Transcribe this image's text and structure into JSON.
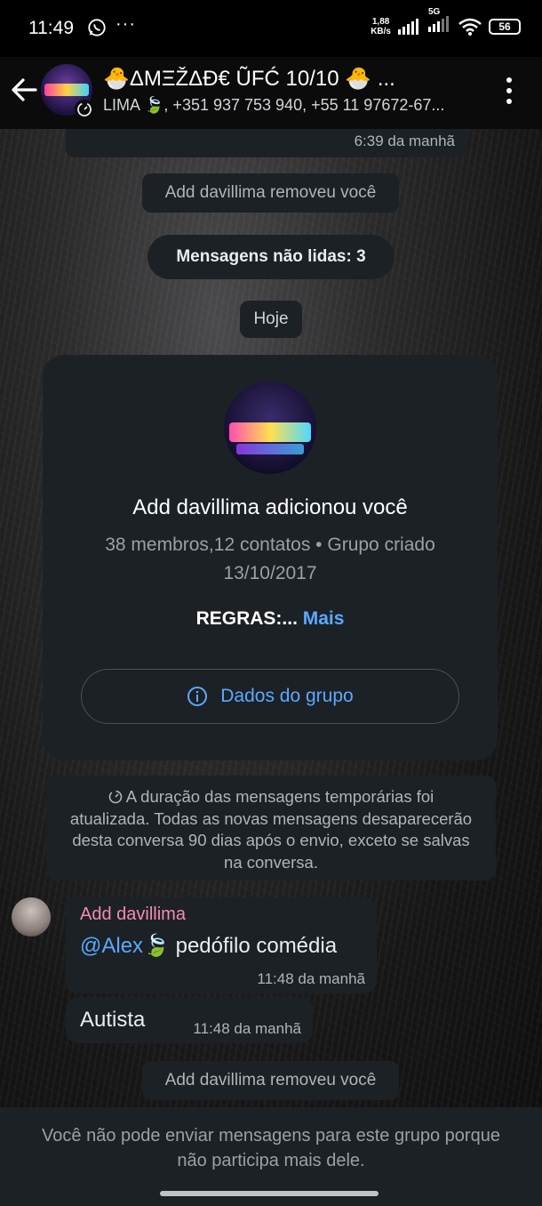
{
  "status_bar": {
    "time": "11:49",
    "dots": "···",
    "speed_line1": "1,88",
    "speed_line2": "KB/s",
    "network": "5G",
    "battery": "56"
  },
  "header": {
    "title": "🐣ΔΜΞŽΔĐ€ ŨFĆ 10/10 🐣 ...",
    "subtitle": "LIMA 🍃, +351 937 753 940, +55 11 97672-67..."
  },
  "chat": {
    "prev_message_time": "6:39 da manhã",
    "removed_notice_1": "Add davillima removeu você",
    "unread_label": "Mensagens não lidas: 3",
    "date_chip": "Hoje",
    "group_card": {
      "title": "Add davillima adicionou você",
      "meta": "38 membros,12 contatos • Grupo criado 13/10/2017",
      "rules": "REGRAS:...",
      "more": "Mais",
      "group_info_button": "Dados do grupo"
    },
    "disappearing_notice": "A duração das mensagens temporárias foi atualizada. Todas as novas mensagens desaparecerão desta conversa 90 dias após o envio, exceto se salvas na conversa.",
    "messages": [
      {
        "sender": "Add davillima",
        "mention": "@Alex🍃",
        "text": " pedófilo comédia",
        "time": "11:48 da manhã"
      },
      {
        "text": "Autista",
        "time": "11:48 da manhã"
      }
    ],
    "removed_notice_2": "Add davillima removeu você"
  },
  "footer": {
    "text": "Você não pode enviar mensagens para este grupo porque não participa mais dele."
  },
  "colors": {
    "bubble": "#1c2126",
    "accent_blue": "#5aa9ff",
    "sender_pink": "#f38bb3"
  }
}
